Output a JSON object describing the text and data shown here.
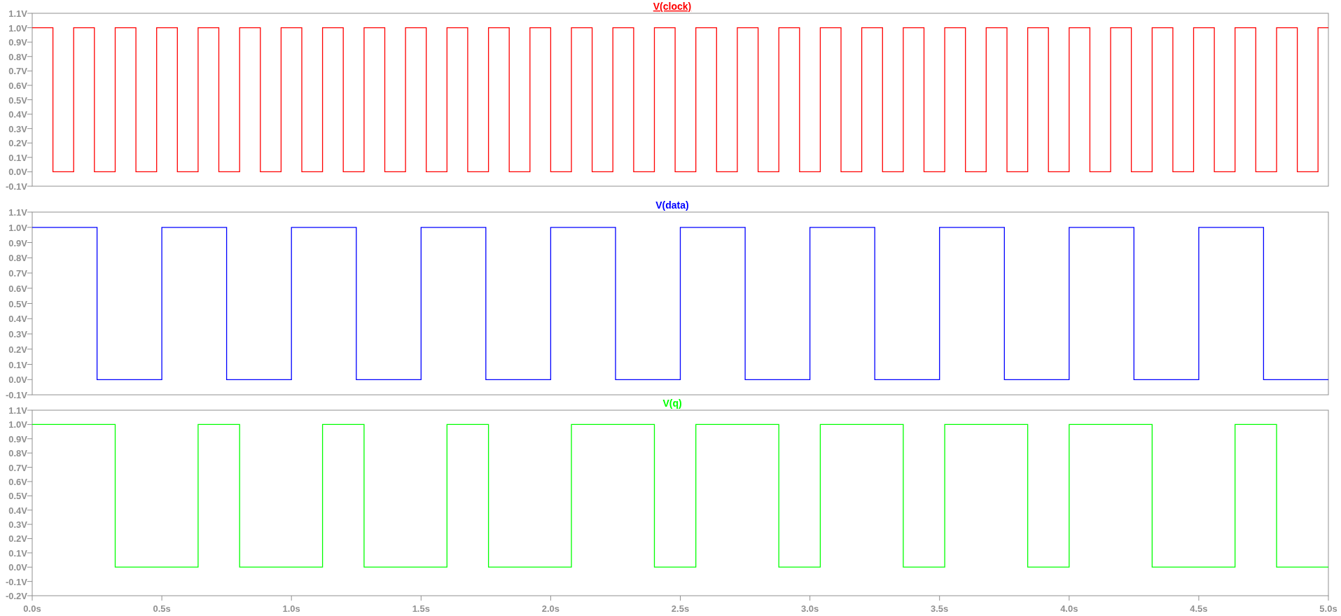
{
  "panes": [
    {
      "selected": true,
      "chart_data": {
        "type": "line",
        "xlim": [
          0,
          5
        ],
        "ylim": [
          -0.1,
          1.1
        ],
        "yticks": [
          {
            "value": 1.1,
            "label": "1.1V"
          },
          {
            "value": 1.0,
            "label": "1.0V"
          },
          {
            "value": 0.9,
            "label": "0.9V"
          },
          {
            "value": 0.8,
            "label": "0.8V"
          },
          {
            "value": 0.7,
            "label": "0.7V"
          },
          {
            "value": 0.6,
            "label": "0.6V"
          },
          {
            "value": 0.5,
            "label": "0.5V"
          },
          {
            "value": 0.4,
            "label": "0.4V"
          },
          {
            "value": 0.3,
            "label": "0.3V"
          },
          {
            "value": 0.2,
            "label": "0.2V"
          },
          {
            "value": 0.1,
            "label": "0.1V"
          },
          {
            "value": 0.0,
            "label": "0.0V"
          },
          {
            "value": -0.1,
            "label": "-0.1V"
          }
        ],
        "x": [
          0,
          0.08,
          0.08,
          0.16,
          0.16,
          0.24,
          0.24,
          0.32,
          0.32,
          0.4,
          0.4,
          0.48,
          0.48,
          0.56,
          0.56,
          0.64,
          0.64,
          0.72,
          0.72,
          0.8,
          0.8,
          0.88,
          0.88,
          0.96,
          0.96,
          1.04,
          1.04,
          1.12,
          1.12,
          1.2,
          1.2,
          1.28,
          1.28,
          1.36,
          1.36,
          1.44,
          1.44,
          1.52,
          1.52,
          1.6,
          1.6,
          1.68,
          1.68,
          1.76,
          1.76,
          1.84,
          1.84,
          1.92,
          1.92,
          2.0,
          2.0,
          2.08,
          2.08,
          2.16,
          2.16,
          2.24,
          2.24,
          2.32,
          2.32,
          2.4,
          2.4,
          2.48,
          2.48,
          2.56,
          2.56,
          2.64,
          2.64,
          2.72,
          2.72,
          2.8,
          2.8,
          2.88,
          2.88,
          2.96,
          2.96,
          3.04,
          3.04,
          3.12,
          3.12,
          3.2,
          3.2,
          3.28,
          3.28,
          3.36,
          3.36,
          3.44,
          3.44,
          3.52,
          3.52,
          3.6,
          3.6,
          3.68,
          3.68,
          3.76,
          3.76,
          3.84,
          3.84,
          3.92,
          3.92,
          4.0,
          4.0,
          4.08,
          4.08,
          4.16,
          4.16,
          4.24,
          4.24,
          4.32,
          4.32,
          4.4,
          4.4,
          4.48,
          4.48,
          4.56,
          4.56,
          4.64,
          4.64,
          4.72,
          4.72,
          4.8,
          4.8,
          4.88,
          4.88,
          4.96,
          4.96,
          5.0
        ],
        "series": [
          {
            "name": "V(clock)",
            "color": "#ff0000",
            "values": [
              1,
              1,
              0,
              0,
              1,
              1,
              0,
              0,
              1,
              1,
              0,
              0,
              1,
              1,
              0,
              0,
              1,
              1,
              0,
              0,
              1,
              1,
              0,
              0,
              1,
              1,
              0,
              0,
              1,
              1,
              0,
              0,
              1,
              1,
              0,
              0,
              1,
              1,
              0,
              0,
              1,
              1,
              0,
              0,
              1,
              1,
              0,
              0,
              1,
              1,
              0,
              0,
              1,
              1,
              0,
              0,
              1,
              1,
              0,
              0,
              1,
              1,
              0,
              0,
              1,
              1,
              0,
              0,
              1,
              1,
              0,
              0,
              1,
              1,
              0,
              0,
              1,
              1,
              0,
              0,
              1,
              1,
              0,
              0,
              1,
              1,
              0,
              0,
              1,
              1,
              0,
              0,
              1,
              1,
              0,
              0,
              1,
              1,
              0,
              0,
              1,
              1,
              0,
              0,
              1,
              1,
              0,
              0,
              1,
              1,
              0,
              0,
              1,
              1,
              0,
              0,
              1,
              1,
              0,
              0,
              1,
              1,
              0,
              0,
              1,
              1
            ]
          }
        ]
      }
    },
    {
      "selected": false,
      "chart_data": {
        "type": "line",
        "xlim": [
          0,
          5
        ],
        "ylim": [
          -0.1,
          1.1
        ],
        "yticks": [
          {
            "value": 1.1,
            "label": "1.1V"
          },
          {
            "value": 1.0,
            "label": "1.0V"
          },
          {
            "value": 0.9,
            "label": "0.9V"
          },
          {
            "value": 0.8,
            "label": "0.8V"
          },
          {
            "value": 0.7,
            "label": "0.7V"
          },
          {
            "value": 0.6,
            "label": "0.6V"
          },
          {
            "value": 0.5,
            "label": "0.5V"
          },
          {
            "value": 0.4,
            "label": "0.4V"
          },
          {
            "value": 0.3,
            "label": "0.3V"
          },
          {
            "value": 0.2,
            "label": "0.2V"
          },
          {
            "value": 0.1,
            "label": "0.1V"
          },
          {
            "value": 0.0,
            "label": "0.0V"
          },
          {
            "value": -0.1,
            "label": "-0.1V"
          }
        ],
        "x": [
          0,
          0.25,
          0.25,
          0.5,
          0.5,
          0.75,
          0.75,
          1.0,
          1.0,
          1.25,
          1.25,
          1.5,
          1.5,
          1.75,
          1.75,
          2.0,
          2.0,
          2.25,
          2.25,
          2.5,
          2.5,
          2.75,
          2.75,
          3.0,
          3.0,
          3.25,
          3.25,
          3.5,
          3.5,
          3.75,
          3.75,
          4.0,
          4.0,
          4.25,
          4.25,
          4.5,
          4.5,
          4.75,
          4.75,
          5.0
        ],
        "series": [
          {
            "name": "V(data)",
            "color": "#0000ff",
            "values": [
              1,
              1,
              0,
              0,
              1,
              1,
              0,
              0,
              1,
              1,
              0,
              0,
              1,
              1,
              0,
              0,
              1,
              1,
              0,
              0,
              1,
              1,
              0,
              0,
              1,
              1,
              0,
              0,
              1,
              1,
              0,
              0,
              1,
              1,
              0,
              0,
              1,
              1,
              0,
              0
            ]
          }
        ]
      }
    },
    {
      "selected": false,
      "chart_data": {
        "type": "line",
        "xlim": [
          0,
          5
        ],
        "ylim": [
          -0.2,
          1.1
        ],
        "yticks": [
          {
            "value": 1.1,
            "label": "1.1V"
          },
          {
            "value": 1.0,
            "label": "1.0V"
          },
          {
            "value": 0.9,
            "label": "0.9V"
          },
          {
            "value": 0.8,
            "label": "0.8V"
          },
          {
            "value": 0.7,
            "label": "0.7V"
          },
          {
            "value": 0.6,
            "label": "0.6V"
          },
          {
            "value": 0.5,
            "label": "0.5V"
          },
          {
            "value": 0.4,
            "label": "0.4V"
          },
          {
            "value": 0.3,
            "label": "0.3V"
          },
          {
            "value": 0.2,
            "label": "0.2V"
          },
          {
            "value": 0.1,
            "label": "0.1V"
          },
          {
            "value": 0.0,
            "label": "0.0V"
          },
          {
            "value": -0.1,
            "label": "-0.1V"
          },
          {
            "value": -0.2,
            "label": "-0.2V"
          }
        ],
        "xticks": [
          {
            "value": 0,
            "label": "0.0s"
          },
          {
            "value": 0.5,
            "label": "0.5s"
          },
          {
            "value": 1.0,
            "label": "1.0s"
          },
          {
            "value": 1.5,
            "label": "1.5s"
          },
          {
            "value": 2.0,
            "label": "2.0s"
          },
          {
            "value": 2.5,
            "label": "2.5s"
          },
          {
            "value": 3.0,
            "label": "3.0s"
          },
          {
            "value": 3.5,
            "label": "3.5s"
          },
          {
            "value": 4.0,
            "label": "4.0s"
          },
          {
            "value": 4.5,
            "label": "4.5s"
          },
          {
            "value": 5.0,
            "label": "5.0s"
          }
        ],
        "x": [
          0,
          0.32,
          0.32,
          0.64,
          0.64,
          0.8,
          0.8,
          1.12,
          1.12,
          1.28,
          1.28,
          1.6,
          1.6,
          1.76,
          1.76,
          2.08,
          2.08,
          2.4,
          2.4,
          2.56,
          2.56,
          2.88,
          2.88,
          3.04,
          3.04,
          3.36,
          3.36,
          3.52,
          3.52,
          3.84,
          3.84,
          4.0,
          4.0,
          4.32,
          4.32,
          4.64,
          4.64,
          4.8,
          4.8,
          5.0
        ],
        "series": [
          {
            "name": "V(q)",
            "color": "#00ff00",
            "values": [
              1,
              1,
              0,
              0,
              1,
              1,
              0,
              0,
              1,
              1,
              0,
              0,
              1,
              1,
              0,
              0,
              1,
              1,
              0,
              0,
              1,
              1,
              0,
              0,
              1,
              1,
              0,
              0,
              1,
              1,
              0,
              0,
              1,
              1,
              0,
              0,
              1,
              1,
              0,
              0
            ]
          }
        ]
      }
    }
  ]
}
